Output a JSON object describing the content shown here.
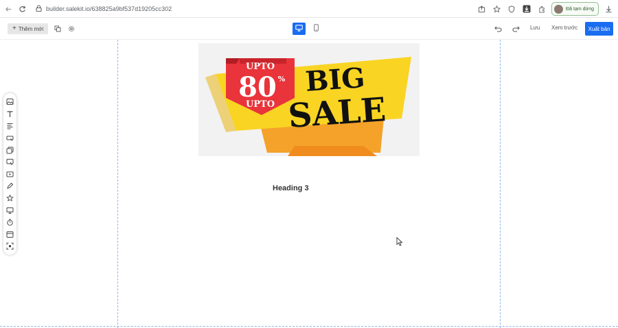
{
  "browser": {
    "url": "builder.salekit.io/638825a9bf537d19205cc302",
    "profile_status": "Đã tạm dừng"
  },
  "toolbar": {
    "add_label": "Thêm mới",
    "save_label": "Lưu",
    "preview_label": "Xem trước",
    "publish_label": "Xuất bản",
    "active_device": "desktop",
    "accent_color": "#1a6cf0"
  },
  "canvas": {
    "banner": {
      "upto_top": "UPTO",
      "percent_value": "80",
      "percent_sign": "%",
      "upto_bottom": "UPTO",
      "big": "BIG",
      "sale": "SALE",
      "ribbon_color": "#f9d423",
      "badge_color": "#e8343a"
    },
    "heading": "Heading 3"
  },
  "left_toolbox": {
    "tools": [
      "image-icon",
      "text-icon",
      "paragraph-icon",
      "button-icon",
      "gallery-icon",
      "form-icon",
      "video-icon",
      "pen-icon",
      "star-icon",
      "monitor-icon",
      "timer-icon",
      "section-icon",
      "frame-icon"
    ]
  }
}
